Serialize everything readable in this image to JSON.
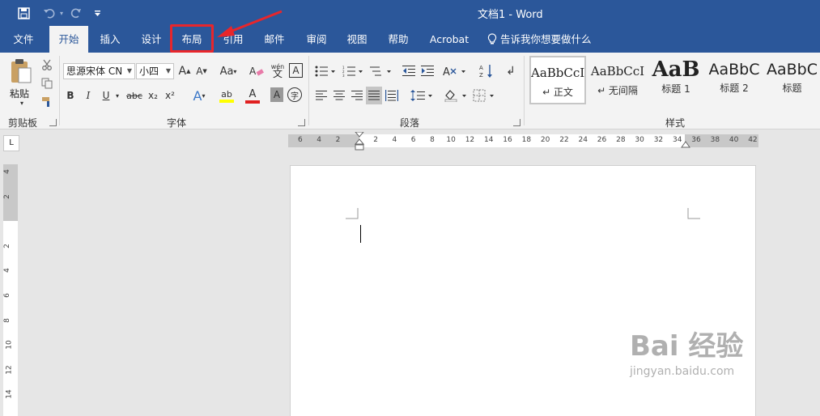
{
  "window": {
    "title": "文档1  -  Word"
  },
  "quick_access": {
    "save_icon": "save-icon",
    "undo_icon": "undo-icon",
    "redo_icon": "redo-icon",
    "customize_icon": "customize-icon"
  },
  "tabs": [
    {
      "label": "文件"
    },
    {
      "label": "开始"
    },
    {
      "label": "插入"
    },
    {
      "label": "设计"
    },
    {
      "label": "布局"
    },
    {
      "label": "引用"
    },
    {
      "label": "邮件"
    },
    {
      "label": "审阅"
    },
    {
      "label": "视图"
    },
    {
      "label": "帮助"
    },
    {
      "label": "Acrobat"
    },
    {
      "label": "告诉我你想要做什么"
    }
  ],
  "clipboard": {
    "paste_label": "粘贴",
    "group_label": "剪贴板"
  },
  "font": {
    "font_name": "思源宋体 CN",
    "font_size": "小四",
    "grow": "A",
    "shrink": "A",
    "case": "Aa",
    "phonetic": "wén",
    "bold": "B",
    "italic": "I",
    "underline": "U",
    "strike": "abc",
    "subscript": "x₂",
    "superscript": "x²",
    "effects": "A",
    "highlight": "ab",
    "color": "A",
    "shade": "A",
    "border": "A",
    "enclose": "字",
    "group_label": "字体"
  },
  "paragraph": {
    "group_label": "段落"
  },
  "styles": {
    "group_label": "样式",
    "items": [
      {
        "sample": "AaBbCcI",
        "name": "↵ 正文"
      },
      {
        "sample": "AaBbCcI",
        "name": "↵ 无间隔"
      },
      {
        "sample": "AaB",
        "name": "标题 1"
      },
      {
        "sample": "AaBbC",
        "name": "标题 2"
      },
      {
        "sample": "AaBbC",
        "name": "标题"
      }
    ]
  },
  "ruler": {
    "corner": "L",
    "h_ticks": [
      "6",
      "4",
      "2",
      "",
      "2",
      "4",
      "6",
      "8",
      "10",
      "12",
      "14",
      "16",
      "18",
      "20",
      "22",
      "24",
      "26",
      "28",
      "30",
      "32",
      "34",
      "36",
      "38",
      "40",
      "42"
    ],
    "v_ticks": [
      "4",
      "2",
      "",
      "2",
      "4",
      "6",
      "8",
      "10",
      "12",
      "14"
    ]
  },
  "watermark": {
    "main": "Bai 经验",
    "sub": "jingyan.baidu.com"
  },
  "colors": {
    "accent": "#2b579a",
    "highlight": "#e8262b"
  }
}
